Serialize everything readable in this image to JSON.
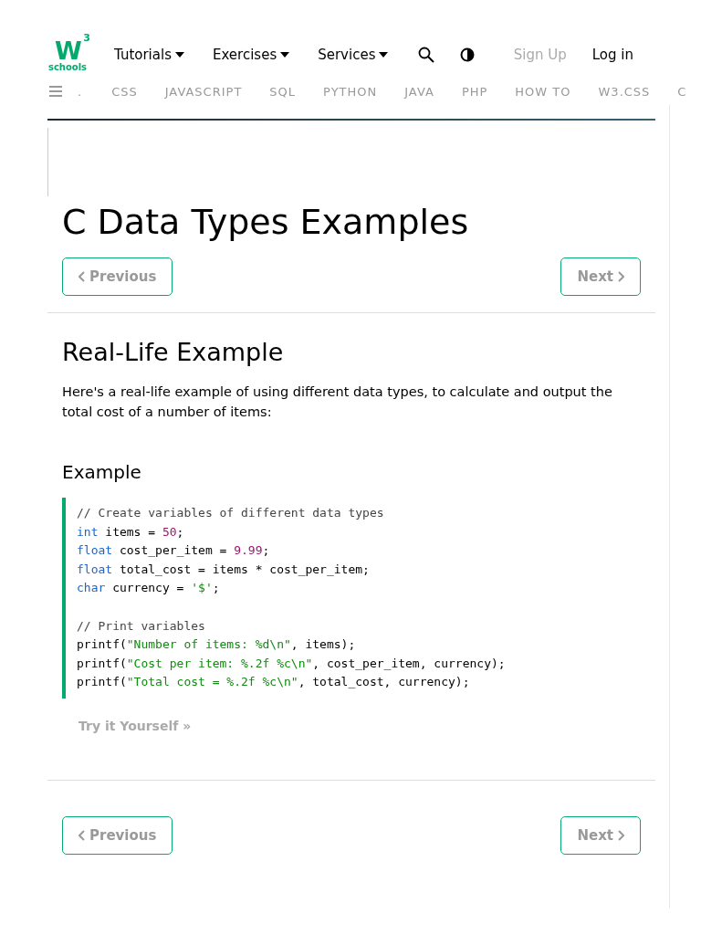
{
  "logo": {
    "letter": "W",
    "sup": "3",
    "word": "schools"
  },
  "menu": [
    {
      "label": "Tutorials",
      "dropdown": true
    },
    {
      "label": "Exercises",
      "dropdown": true
    },
    {
      "label": "Services",
      "dropdown": true
    }
  ],
  "account": [
    {
      "label": "Sign Up",
      "kind": "muted"
    },
    {
      "label": "Log in",
      "kind": "strong"
    }
  ],
  "topics": [
    ".",
    "CSS",
    "JAVASCRIPT",
    "SQL",
    "PYTHON",
    "JAVA",
    "PHP",
    "HOW TO",
    "W3.CSS",
    "C"
  ],
  "title": "C Data Types Examples",
  "pager_top": {
    "previous": "Previous",
    "next": "Next"
  },
  "section": {
    "heading": "Real-Life Example",
    "text": "Here's a real-life example of using different data types, to calculate and output the total cost of a number of items:",
    "example_heading": "Example"
  },
  "code": [
    [
      [
        {
          "kind": "comment",
          "text": "// Create variables of different data types"
        }
      ],
      [
        {
          "kind": "keyword",
          "text": "int"
        },
        {
          "kind": "plain",
          "text": " items = "
        },
        {
          "kind": "number",
          "text": "50"
        },
        {
          "kind": "plain",
          "text": ";"
        }
      ],
      [
        {
          "kind": "keyword",
          "text": "float"
        },
        {
          "kind": "plain",
          "text": " cost_per_item = "
        },
        {
          "kind": "number",
          "text": "9.99"
        },
        {
          "kind": "plain",
          "text": ";"
        }
      ],
      [
        {
          "kind": "keyword",
          "text": "float"
        },
        {
          "kind": "plain",
          "text": " total_cost = items * cost_per_item;"
        }
      ],
      [
        {
          "kind": "keyword",
          "text": "char"
        },
        {
          "kind": "plain",
          "text": " currency = "
        },
        {
          "kind": "string",
          "text": "'$'"
        },
        {
          "kind": "plain",
          "text": ";"
        }
      ]
    ],
    [
      [
        {
          "kind": "comment",
          "text": "// Print variables"
        }
      ],
      [
        {
          "kind": "plain",
          "text": "printf("
        },
        {
          "kind": "string",
          "text": "\"Number of items: %d\\n\""
        },
        {
          "kind": "plain",
          "text": ", items);"
        }
      ],
      [
        {
          "kind": "plain",
          "text": "printf("
        },
        {
          "kind": "string",
          "text": "\"Cost per item: %.2f %c\\n\""
        },
        {
          "kind": "plain",
          "text": ", cost_per_item, currency);"
        }
      ],
      [
        {
          "kind": "plain",
          "text": "printf("
        },
        {
          "kind": "string",
          "text": "\"Total cost = %.2f %c\\n\""
        },
        {
          "kind": "plain",
          "text": ", total_cost, currency);"
        }
      ]
    ]
  ],
  "try_link": "Try it Yourself »",
  "pager_bottom": {
    "previous": "Previous",
    "next": "Next"
  }
}
